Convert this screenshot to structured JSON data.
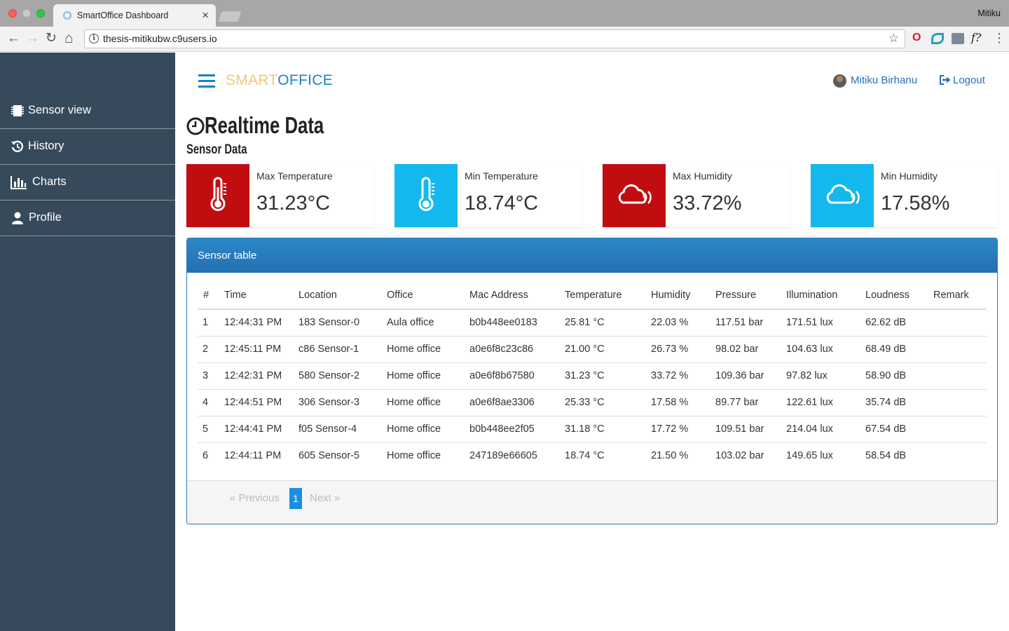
{
  "browser": {
    "tab_title": "SmartOffice Dashboard",
    "tab_close": "×",
    "window_user": "Mitiku",
    "url": "thesis-mitikubw.c9users.io",
    "info": "i",
    "star": "☆",
    "back": "←",
    "forward": "→",
    "reload": "↻",
    "home": "⌂",
    "ext_opera": "O",
    "ext_fquestion": "f?",
    "menu": "⋮"
  },
  "brand": {
    "part1": "SMART",
    "part2": "OFFICE",
    "color1": "#f1c77a",
    "color2": "#1b82c5"
  },
  "header": {
    "user_name": "Mitiku Birhanu",
    "logout": "Logout"
  },
  "sidebar": {
    "background": "#374a5b",
    "items": [
      {
        "label": "Sensor view",
        "icon": "chip-icon"
      },
      {
        "label": "History",
        "icon": "history-icon"
      },
      {
        "label": "Charts",
        "icon": "bar-chart-icon"
      },
      {
        "label": "Profile",
        "icon": "user-icon"
      }
    ]
  },
  "page": {
    "title": "Realtime Data",
    "subtitle": "Sensor Data"
  },
  "cards": [
    {
      "label": "Max Temperature",
      "value": "31.23",
      "unit": "°C",
      "color": "#c10d10",
      "icon": "thermometer-icon"
    },
    {
      "label": "Min Temperature",
      "value": "18.74",
      "unit": "°C",
      "color": "#13b9ee",
      "icon": "thermometer-icon"
    },
    {
      "label": "Max Humidity",
      "value": "33.72",
      "unit": "%",
      "color": "#c10d10",
      "icon": "humidity-cloud-icon"
    },
    {
      "label": "Min Humidity",
      "value": "17.58",
      "unit": "%",
      "color": "#13b9ee",
      "icon": "humidity-cloud-icon"
    }
  ],
  "table": {
    "title": "Sensor table",
    "columns": [
      "#",
      "Time",
      "Location",
      "Office",
      "Mac Address",
      "Temperature",
      "Humidity",
      "Pressure",
      "Illumination",
      "Loudness",
      "Remark"
    ],
    "rows": [
      [
        "1",
        "12:44:31 PM",
        "183 Sensor-0",
        "Aula office",
        "b0b448ee0183",
        "25.81 °C",
        "22.03 %",
        "117.51 bar",
        "171.51 lux",
        "62.62 dB",
        ""
      ],
      [
        "2",
        "12:45:11 PM",
        "c86 Sensor-1",
        "Home office",
        "a0e6f8c23c86",
        "21.00 °C",
        "26.73 %",
        "98.02 bar",
        "104.63 lux",
        "68.49 dB",
        ""
      ],
      [
        "3",
        "12:42:31 PM",
        "580 Sensor-2",
        "Home office",
        "a0e6f8b67580",
        "31.23 °C",
        "33.72 %",
        "109.36 bar",
        "97.82 lux",
        "58.90 dB",
        ""
      ],
      [
        "4",
        "12:44:51 PM",
        "306 Sensor-3",
        "Home office",
        "a0e6f8ae3306",
        "25.33 °C",
        "17.58 %",
        "89.77 bar",
        "122.61 lux",
        "35.74 dB",
        ""
      ],
      [
        "5",
        "12:44:41 PM",
        "f05 Sensor-4",
        "Home office",
        "b0b448ee2f05",
        "31.18 °C",
        "17.72 %",
        "109.51 bar",
        "214.04 lux",
        "67.54 dB",
        ""
      ],
      [
        "6",
        "12:44:11 PM",
        "605 Sensor-5",
        "Home office",
        "247189e66605",
        "18.74 °C",
        "21.50 %",
        "103.02 bar",
        "149.65 lux",
        "58.54 dB",
        ""
      ]
    ]
  },
  "pagination": {
    "prev": "«  Previous",
    "current": "1",
    "next": "Next  »"
  }
}
